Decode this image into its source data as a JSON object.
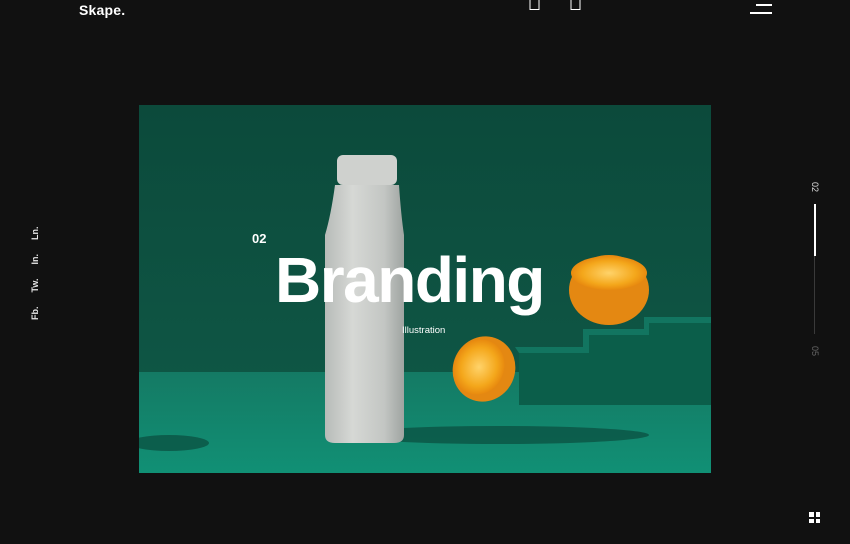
{
  "header": {
    "logo": "Skape.",
    "prev_icon": "arrow-left-icon",
    "next_icon": "arrow-right-icon",
    "menu_icon": "menu-icon"
  },
  "social": {
    "items": [
      "Fb.",
      "Tw.",
      "In.",
      "Ln."
    ]
  },
  "slide": {
    "number": "02",
    "title": "Branding",
    "subtitle": "Illustration",
    "image_description_icon": "bottle-orange-scene"
  },
  "progress": {
    "current": "02",
    "total": "05",
    "fraction": 0.4
  },
  "footer": {
    "grid_icon": "grid-icon"
  },
  "colors": {
    "background": "#111111",
    "hero_backdrop": "#0e5141",
    "hero_table": "#13806a",
    "accent_orange": "#f3a21c",
    "text": "#ffffff"
  }
}
